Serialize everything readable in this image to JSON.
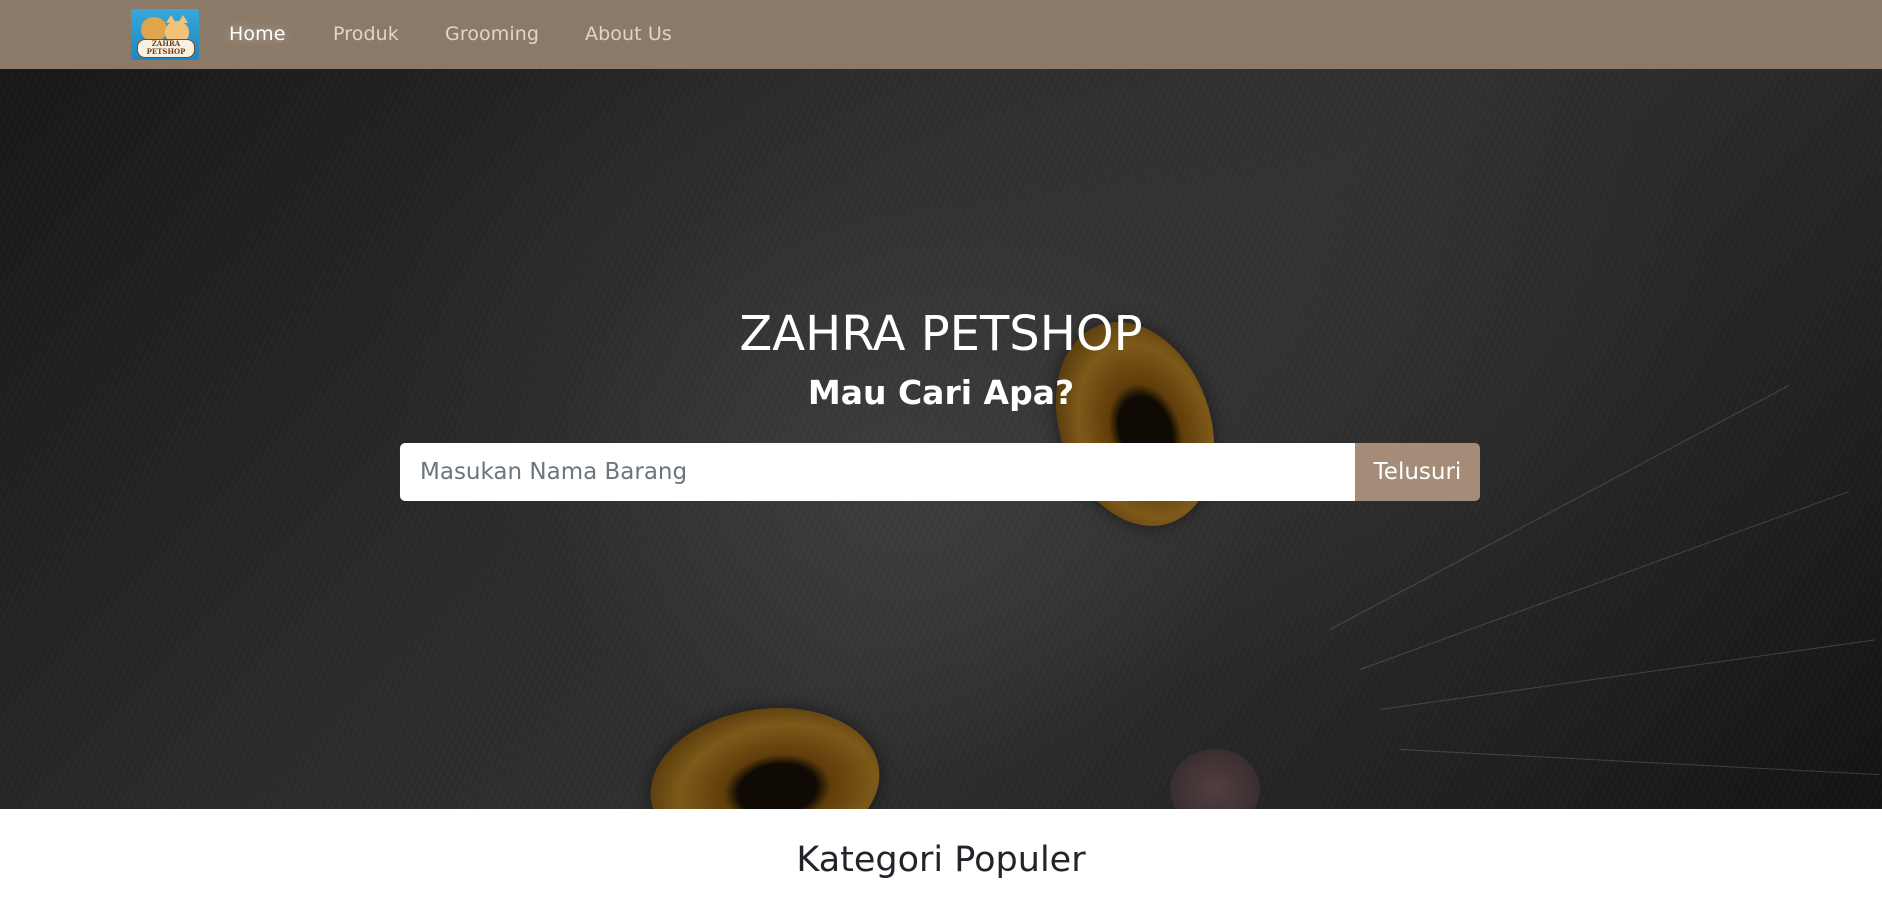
{
  "navbar": {
    "logo_text": "ZAHRA PETSHOP",
    "items": [
      {
        "label": "Home",
        "active": true
      },
      {
        "label": "Produk"
      },
      {
        "label": "Grooming"
      },
      {
        "label": "About Us"
      }
    ]
  },
  "hero": {
    "title": "ZAHRA PETSHOP",
    "subtitle": "Mau Cari Apa?",
    "search": {
      "placeholder": "Masukan Nama Barang",
      "value": "",
      "button_label": "Telusuri"
    }
  },
  "section": {
    "title": "Kategori Populer"
  },
  "colors": {
    "navbar": "#8c7a68",
    "accent": "#a48c78"
  }
}
